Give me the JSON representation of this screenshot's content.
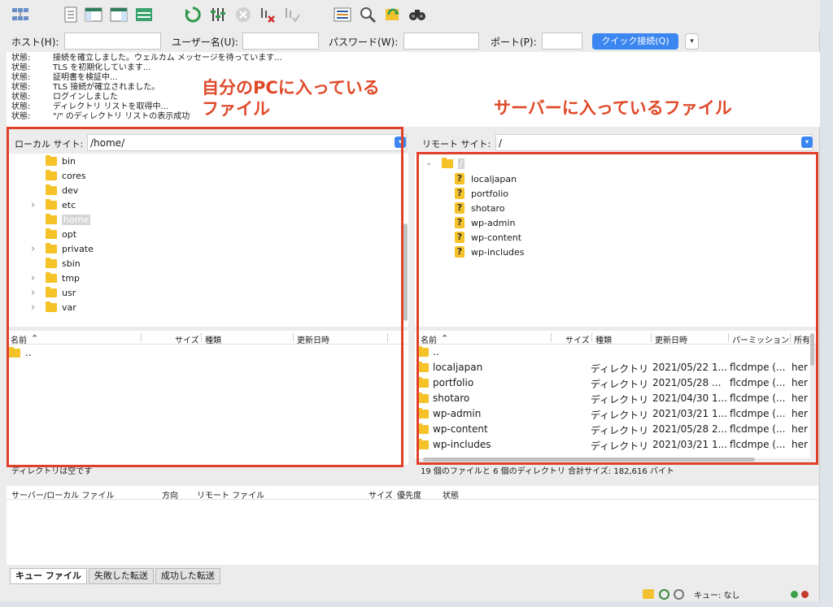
{
  "quickconnect": {
    "host_label": "ホスト(H):",
    "user_label": "ユーザー名(U):",
    "pass_label": "パスワード(W):",
    "port_label": "ポート(P):",
    "host_value": "",
    "user_value": "",
    "pass_value": "",
    "port_value": "",
    "connect_label": "クイック接続(Q)",
    "dropdown_glyph": "▾"
  },
  "log": [
    {
      "k": "状態:",
      "v": "接続を確立しました。ウェルカム メッセージを待っています..."
    },
    {
      "k": "状態:",
      "v": "TLS を初期化しています..."
    },
    {
      "k": "状態:",
      "v": "証明書を検証中..."
    },
    {
      "k": "状態:",
      "v": "TLS 接続が確立されました。"
    },
    {
      "k": "状態:",
      "v": "ログインしました"
    },
    {
      "k": "状態:",
      "v": "ディレクトリ リストを取得中..."
    },
    {
      "k": "状態:",
      "v": "\"/\" のディレクトリ リストの表示成功"
    }
  ],
  "annotations": {
    "local_line1": "自分のPCに入っている",
    "local_line2": "ファイル",
    "remote": "サーバーに入っているファイル"
  },
  "local": {
    "site_label": "ローカル サイト:",
    "path": "/home/",
    "tree": [
      {
        "name": "bin",
        "expandable": false
      },
      {
        "name": "cores",
        "expandable": false
      },
      {
        "name": "dev",
        "expandable": false
      },
      {
        "name": "etc",
        "expandable": true
      },
      {
        "name": "home",
        "expandable": false,
        "selected": true
      },
      {
        "name": "opt",
        "expandable": false
      },
      {
        "name": "private",
        "expandable": true
      },
      {
        "name": "sbin",
        "expandable": false
      },
      {
        "name": "tmp",
        "expandable": true
      },
      {
        "name": "usr",
        "expandable": true
      },
      {
        "name": "var",
        "expandable": true
      }
    ],
    "columns": {
      "name": "名前",
      "size": "サイズ",
      "type": "種類",
      "modified": "更新日時"
    },
    "files": [
      ".."
    ],
    "status": "ディレクトリは空です"
  },
  "remote": {
    "site_label": "リモート サイト:",
    "path": "/",
    "root": "/",
    "tree": [
      "localjapan",
      "portfolio",
      "shotaro",
      "wp-admin",
      "wp-content",
      "wp-includes"
    ],
    "columns": {
      "name": "名前",
      "size": "サイズ",
      "type": "種類",
      "modified": "更新日時",
      "perms": "パーミッション",
      "owner": "所有"
    },
    "files": [
      {
        "name": "..",
        "type": "",
        "modified": "",
        "perms": "",
        "owner": ""
      },
      {
        "name": "localjapan",
        "type": "ディレクトリ",
        "modified": "2021/05/22 1...",
        "perms": "flcdmpe (...",
        "owner": "her"
      },
      {
        "name": "portfolio",
        "type": "ディレクトリ",
        "modified": "2021/05/28 ...",
        "perms": "flcdmpe (...",
        "owner": "her"
      },
      {
        "name": "shotaro",
        "type": "ディレクトリ",
        "modified": "2021/04/30 1...",
        "perms": "flcdmpe (...",
        "owner": "her"
      },
      {
        "name": "wp-admin",
        "type": "ディレクトリ",
        "modified": "2021/03/21 1...",
        "perms": "flcdmpe (...",
        "owner": "her"
      },
      {
        "name": "wp-content",
        "type": "ディレクトリ",
        "modified": "2021/05/28 2...",
        "perms": "flcdmpe (...",
        "owner": "her"
      },
      {
        "name": "wp-includes",
        "type": "ディレクトリ",
        "modified": "2021/03/21 1...",
        "perms": "flcdmpe (...",
        "owner": "her"
      }
    ],
    "status": "19 個のファイルと 6 個のディレクトリ 合計サイズ: 182,616 バイト"
  },
  "queue": {
    "columns": {
      "file": "サーバー/ローカル ファイル",
      "dir": "方向",
      "remote": "リモート ファイル",
      "size": "サイズ",
      "priority": "優先度",
      "status": "状態"
    },
    "tabs": [
      "キュー ファイル",
      "失敗した転送",
      "成功した転送"
    ],
    "queue_status": "キュー: なし"
  },
  "colors": {
    "accent": "#3b86f0",
    "annotation": "#e0402a",
    "folder": "#f5c228"
  }
}
